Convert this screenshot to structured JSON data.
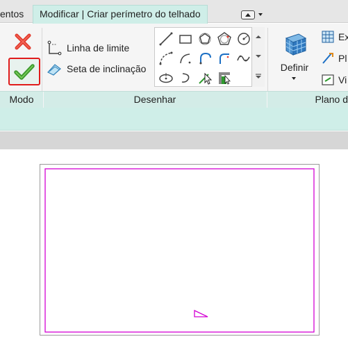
{
  "tabs": {
    "previous_partial": "entos",
    "active": "Modificar | Criar perímetro do telhado"
  },
  "ribbon": {
    "panels": {
      "modo": "Modo",
      "desenhar": "Desenhar",
      "plano_trabalho_partial": "Plano d"
    },
    "modo": {
      "cancel_icon": "red-x-icon",
      "finish_icon": "green-check-icon"
    },
    "draw_tools": {
      "boundary_line": "Linha de limite",
      "slope_arrow": "Seta de inclinação"
    },
    "work_plane": {
      "definir": "Definir",
      "items_partial": [
        "Ex",
        "Pl",
        "Vi"
      ]
    }
  },
  "colors": {
    "accent_teal": "#cfeee8",
    "sketch_magenta": "#d400d4",
    "finish_highlight": "#e01b1b"
  }
}
